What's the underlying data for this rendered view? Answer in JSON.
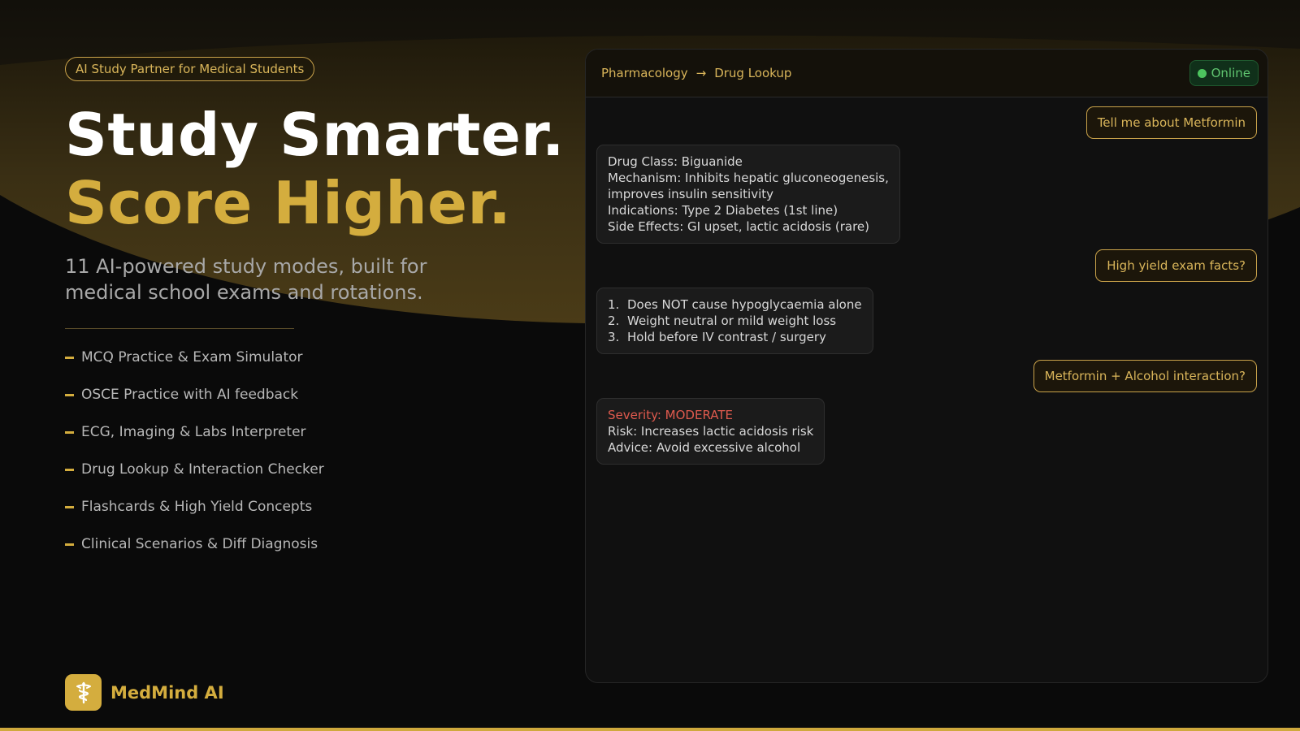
{
  "hero": {
    "badge": "AI Study Partner for Medical Students",
    "headline_line1": "Study Smarter.",
    "headline_line2": "Score Higher.",
    "subtitle": "11 AI-powered study modes, built for medical school exams and rotations."
  },
  "features": [
    "MCQ Practice & Exam Simulator",
    "OSCE Practice with AI feedback",
    "ECG, Imaging & Labs Interpreter",
    "Drug Lookup & Interaction Checker",
    "Flashcards & High Yield Concepts",
    "Clinical Scenarios & Diff Diagnosis"
  ],
  "brand": {
    "name": "MedMind AI",
    "icon": "caduceus-icon"
  },
  "chat": {
    "breadcrumb": {
      "section": "Pharmacology",
      "separator": "→",
      "page": "Drug Lookup"
    },
    "status": "Online",
    "messages": {
      "user1": "Tell me about Metformin",
      "bot1": [
        "Drug Class: Biguanide",
        "Mechanism: Inhibits hepatic gluconeogenesis,",
        "improves insulin sensitivity",
        "Indications: Type 2 Diabetes (1st line)",
        "Side Effects: GI upset, lactic acidosis (rare)"
      ],
      "user2": "High yield exam facts?",
      "bot2": [
        {
          "num": "1.",
          "text": "Does NOT cause hypoglycaemia alone"
        },
        {
          "num": "2.",
          "text": "Weight neutral or mild weight loss"
        },
        {
          "num": "3.",
          "text": "Hold before IV contrast / surgery"
        }
      ],
      "user3": "Metformin + Alcohol interaction?",
      "bot3": {
        "severity": "Severity: MODERATE",
        "risk": "Risk: Increases lactic acidosis risk",
        "advice": "Advice: Avoid excessive alcohol"
      }
    }
  },
  "colors": {
    "accent": "#d4ad3e",
    "background": "#0a0a0a",
    "online": "#4cc45e",
    "severity": "#e05a4e"
  }
}
